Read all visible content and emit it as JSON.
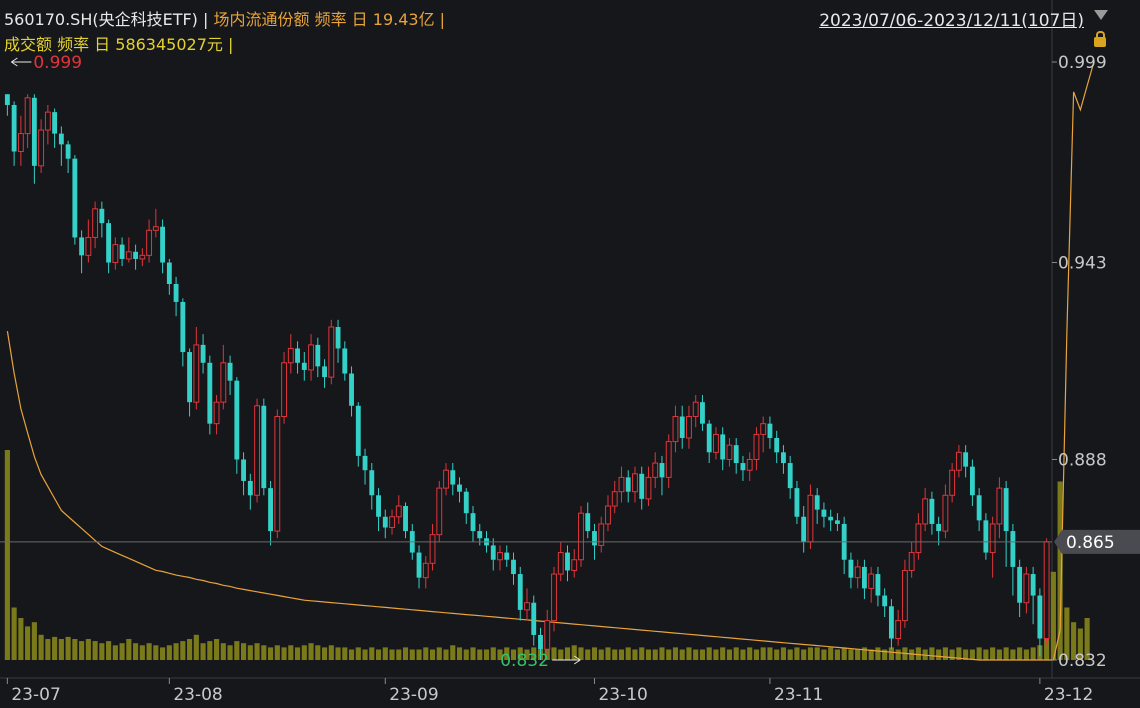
{
  "header": {
    "code": "560170.SH(央企科技ETF)",
    "sep": " | ",
    "metric": "场内流通份额 频率 日 19.43亿 |",
    "line2": "成交额 频率 日 586345027元 |",
    "date_range": "2023/07/06-2023/12/11(107日)"
  },
  "icons": {
    "dropdown": "chevron-down-icon",
    "lock": "lock-icon"
  },
  "colors": {
    "up": "#e0353a",
    "down": "#33d1c8",
    "volume": "#7a7a1a",
    "share_line": "#e8a33a",
    "crosshair": "#6a6a6a"
  },
  "chart_data": {
    "type": "candlestick",
    "price_axis": {
      "min": 0.832,
      "max": 0.999,
      "ticks": [
        "0.999",
        "0.943",
        "0.888",
        "0.832"
      ]
    },
    "x_ticks": [
      {
        "label": "23-07",
        "index": 0
      },
      {
        "label": "23-08",
        "index": 24
      },
      {
        "label": "23-09",
        "index": 56
      },
      {
        "label": "23-10",
        "index": 87
      },
      {
        "label": "23-11",
        "index": 113
      },
      {
        "label": "23-12",
        "index": 153
      }
    ],
    "high_marker": {
      "label": "0.999",
      "index": 0
    },
    "low_marker": {
      "label": "0.832",
      "index": 84
    },
    "crosshair": {
      "label": "0.865",
      "value": 0.865
    },
    "candles": [
      [
        0.99,
        0.987,
        0.99,
        0.984
      ],
      [
        0.987,
        0.974,
        0.988,
        0.97
      ],
      [
        0.974,
        0.979,
        0.984,
        0.97
      ],
      [
        0.979,
        0.989,
        0.99,
        0.975
      ],
      [
        0.989,
        0.97,
        0.99,
        0.965
      ],
      [
        0.97,
        0.98,
        0.983,
        0.968
      ],
      [
        0.98,
        0.985,
        0.987,
        0.976
      ],
      [
        0.985,
        0.979,
        0.986,
        0.975
      ],
      [
        0.979,
        0.976,
        0.981,
        0.97
      ],
      [
        0.976,
        0.972,
        0.977,
        0.968
      ],
      [
        0.972,
        0.95,
        0.973,
        0.948
      ],
      [
        0.95,
        0.945,
        0.952,
        0.94
      ],
      [
        0.945,
        0.95,
        0.955,
        0.943
      ],
      [
        0.95,
        0.958,
        0.96,
        0.947
      ],
      [
        0.958,
        0.954,
        0.96,
        0.95
      ],
      [
        0.954,
        0.943,
        0.955,
        0.94
      ],
      [
        0.943,
        0.948,
        0.95,
        0.941
      ],
      [
        0.948,
        0.944,
        0.95,
        0.942
      ],
      [
        0.944,
        0.946,
        0.95,
        0.943
      ],
      [
        0.946,
        0.944,
        0.948,
        0.941
      ],
      [
        0.944,
        0.945,
        0.947,
        0.942
      ],
      [
        0.945,
        0.952,
        0.955,
        0.943
      ],
      [
        0.952,
        0.953,
        0.958,
        0.95
      ],
      [
        0.953,
        0.943,
        0.955,
        0.94
      ],
      [
        0.943,
        0.937,
        0.944,
        0.934
      ],
      [
        0.937,
        0.932,
        0.939,
        0.928
      ],
      [
        0.932,
        0.918,
        0.933,
        0.914
      ],
      [
        0.918,
        0.904,
        0.919,
        0.9
      ],
      [
        0.904,
        0.92,
        0.925,
        0.902
      ],
      [
        0.92,
        0.915,
        0.923,
        0.912
      ],
      [
        0.915,
        0.898,
        0.917,
        0.895
      ],
      [
        0.898,
        0.904,
        0.906,
        0.895
      ],
      [
        0.904,
        0.915,
        0.92,
        0.902
      ],
      [
        0.915,
        0.91,
        0.917,
        0.906
      ],
      [
        0.91,
        0.888,
        0.911,
        0.884
      ],
      [
        0.888,
        0.882,
        0.89,
        0.878
      ],
      [
        0.882,
        0.878,
        0.884,
        0.874
      ],
      [
        0.878,
        0.903,
        0.905,
        0.876
      ],
      [
        0.903,
        0.88,
        0.905,
        0.878
      ],
      [
        0.88,
        0.868,
        0.882,
        0.864
      ],
      [
        0.868,
        0.9,
        0.902,
        0.866
      ],
      [
        0.9,
        0.915,
        0.918,
        0.898
      ],
      [
        0.915,
        0.919,
        0.923,
        0.912
      ],
      [
        0.919,
        0.915,
        0.921,
        0.912
      ],
      [
        0.915,
        0.913,
        0.918,
        0.91
      ],
      [
        0.913,
        0.92,
        0.923,
        0.91
      ],
      [
        0.92,
        0.914,
        0.922,
        0.911
      ],
      [
        0.914,
        0.911,
        0.916,
        0.908
      ],
      [
        0.911,
        0.925,
        0.927,
        0.909
      ],
      [
        0.925,
        0.919,
        0.927,
        0.915
      ],
      [
        0.919,
        0.912,
        0.921,
        0.91
      ],
      [
        0.912,
        0.903,
        0.914,
        0.9
      ],
      [
        0.903,
        0.889,
        0.904,
        0.886
      ],
      [
        0.889,
        0.885,
        0.891,
        0.881
      ],
      [
        0.885,
        0.878,
        0.887,
        0.874
      ],
      [
        0.878,
        0.872,
        0.88,
        0.868
      ],
      [
        0.872,
        0.869,
        0.874,
        0.866
      ],
      [
        0.869,
        0.872,
        0.874,
        0.867
      ],
      [
        0.872,
        0.875,
        0.878,
        0.87
      ],
      [
        0.875,
        0.868,
        0.876,
        0.866
      ],
      [
        0.868,
        0.862,
        0.87,
        0.86
      ],
      [
        0.862,
        0.855,
        0.864,
        0.852
      ],
      [
        0.855,
        0.859,
        0.861,
        0.852
      ],
      [
        0.859,
        0.867,
        0.87,
        0.857
      ],
      [
        0.867,
        0.88,
        0.882,
        0.865
      ],
      [
        0.88,
        0.885,
        0.887,
        0.878
      ],
      [
        0.885,
        0.881,
        0.887,
        0.878
      ],
      [
        0.881,
        0.879,
        0.883,
        0.876
      ],
      [
        0.879,
        0.873,
        0.88,
        0.87
      ],
      [
        0.873,
        0.868,
        0.875,
        0.865
      ],
      [
        0.868,
        0.866,
        0.87,
        0.864
      ],
      [
        0.866,
        0.864,
        0.868,
        0.862
      ],
      [
        0.864,
        0.86,
        0.866,
        0.857
      ],
      [
        0.86,
        0.862,
        0.864,
        0.857
      ],
      [
        0.862,
        0.86,
        0.864,
        0.858
      ],
      [
        0.86,
        0.856,
        0.862,
        0.853
      ],
      [
        0.856,
        0.846,
        0.858,
        0.843
      ],
      [
        0.846,
        0.848,
        0.852,
        0.843
      ],
      [
        0.848,
        0.839,
        0.85,
        0.836
      ],
      [
        0.839,
        0.835,
        0.841,
        0.832
      ],
      [
        0.835,
        0.843,
        0.846,
        0.833
      ],
      [
        0.843,
        0.856,
        0.858,
        0.84
      ],
      [
        0.856,
        0.862,
        0.865,
        0.854
      ],
      [
        0.862,
        0.857,
        0.864,
        0.854
      ],
      [
        0.857,
        0.86,
        0.863,
        0.855
      ],
      [
        0.86,
        0.873,
        0.875,
        0.858
      ],
      [
        0.873,
        0.868,
        0.876,
        0.866
      ],
      [
        0.868,
        0.864,
        0.87,
        0.86
      ],
      [
        0.864,
        0.87,
        0.872,
        0.862
      ],
      [
        0.87,
        0.875,
        0.878,
        0.868
      ],
      [
        0.875,
        0.879,
        0.882,
        0.873
      ],
      [
        0.879,
        0.883,
        0.886,
        0.876
      ],
      [
        0.883,
        0.879,
        0.885,
        0.876
      ],
      [
        0.879,
        0.884,
        0.886,
        0.876
      ],
      [
        0.884,
        0.877,
        0.886,
        0.874
      ],
      [
        0.877,
        0.883,
        0.886,
        0.875
      ],
      [
        0.883,
        0.887,
        0.89,
        0.88
      ],
      [
        0.887,
        0.883,
        0.889,
        0.878
      ],
      [
        0.883,
        0.893,
        0.895,
        0.88
      ],
      [
        0.893,
        0.9,
        0.903,
        0.89
      ],
      [
        0.9,
        0.894,
        0.903,
        0.891
      ],
      [
        0.894,
        0.9,
        0.903,
        0.891
      ],
      [
        0.9,
        0.904,
        0.906,
        0.897
      ],
      [
        0.904,
        0.898,
        0.906,
        0.896
      ],
      [
        0.898,
        0.89,
        0.899,
        0.887
      ],
      [
        0.89,
        0.895,
        0.897,
        0.888
      ],
      [
        0.895,
        0.888,
        0.897,
        0.885
      ],
      [
        0.888,
        0.892,
        0.894,
        0.886
      ],
      [
        0.892,
        0.887,
        0.894,
        0.884
      ],
      [
        0.887,
        0.885,
        0.889,
        0.882
      ],
      [
        0.885,
        0.888,
        0.89,
        0.882
      ],
      [
        0.888,
        0.895,
        0.897,
        0.885
      ],
      [
        0.895,
        0.898,
        0.9,
        0.89
      ],
      [
        0.898,
        0.894,
        0.9,
        0.891
      ],
      [
        0.894,
        0.89,
        0.896,
        0.887
      ],
      [
        0.89,
        0.887,
        0.892,
        0.884
      ],
      [
        0.887,
        0.88,
        0.889,
        0.877
      ],
      [
        0.88,
        0.872,
        0.882,
        0.87
      ],
      [
        0.872,
        0.865,
        0.875,
        0.862
      ],
      [
        0.865,
        0.878,
        0.881,
        0.863
      ],
      [
        0.878,
        0.874,
        0.88,
        0.87
      ],
      [
        0.874,
        0.872,
        0.876,
        0.869
      ],
      [
        0.872,
        0.871,
        0.874,
        0.868
      ],
      [
        0.871,
        0.87,
        0.873,
        0.868
      ],
      [
        0.87,
        0.86,
        0.872,
        0.856
      ],
      [
        0.86,
        0.855,
        0.862,
        0.852
      ],
      [
        0.855,
        0.858,
        0.86,
        0.852
      ],
      [
        0.858,
        0.852,
        0.86,
        0.849
      ],
      [
        0.852,
        0.856,
        0.858,
        0.848
      ],
      [
        0.856,
        0.85,
        0.858,
        0.847
      ],
      [
        0.85,
        0.847,
        0.852,
        0.844
      ],
      [
        0.847,
        0.838,
        0.849,
        0.835
      ],
      [
        0.838,
        0.843,
        0.846,
        0.836
      ],
      [
        0.843,
        0.857,
        0.86,
        0.841
      ],
      [
        0.857,
        0.862,
        0.865,
        0.855
      ],
      [
        0.862,
        0.87,
        0.873,
        0.86
      ],
      [
        0.87,
        0.877,
        0.88,
        0.868
      ],
      [
        0.877,
        0.87,
        0.879,
        0.867
      ],
      [
        0.87,
        0.868,
        0.872,
        0.864
      ],
      [
        0.868,
        0.878,
        0.881,
        0.866
      ],
      [
        0.878,
        0.885,
        0.887,
        0.876
      ],
      [
        0.885,
        0.89,
        0.892,
        0.883
      ],
      [
        0.89,
        0.886,
        0.892,
        0.883
      ],
      [
        0.886,
        0.878,
        0.888,
        0.875
      ],
      [
        0.878,
        0.871,
        0.88,
        0.868
      ],
      [
        0.871,
        0.862,
        0.873,
        0.86
      ],
      [
        0.862,
        0.87,
        0.872,
        0.855
      ],
      [
        0.87,
        0.88,
        0.883,
        0.866
      ],
      [
        0.88,
        0.868,
        0.882,
        0.858
      ],
      [
        0.868,
        0.858,
        0.87,
        0.85
      ],
      [
        0.858,
        0.848,
        0.86,
        0.844
      ],
      [
        0.848,
        0.856,
        0.858,
        0.845
      ],
      [
        0.856,
        0.85,
        0.858,
        0.842
      ],
      [
        0.85,
        0.838,
        0.852,
        0.833
      ],
      [
        0.838,
        0.865,
        0.866,
        0.836
      ]
    ],
    "volume": [
      1.0,
      0.25,
      0.2,
      0.16,
      0.18,
      0.12,
      0.1,
      0.11,
      0.1,
      0.11,
      0.1,
      0.09,
      0.1,
      0.09,
      0.08,
      0.09,
      0.07,
      0.08,
      0.1,
      0.08,
      0.07,
      0.08,
      0.07,
      0.06,
      0.07,
      0.08,
      0.09,
      0.1,
      0.12,
      0.08,
      0.09,
      0.1,
      0.08,
      0.07,
      0.09,
      0.08,
      0.07,
      0.08,
      0.07,
      0.06,
      0.07,
      0.06,
      0.07,
      0.06,
      0.07,
      0.08,
      0.07,
      0.06,
      0.07,
      0.06,
      0.06,
      0.05,
      0.06,
      0.05,
      0.06,
      0.05,
      0.06,
      0.05,
      0.05,
      0.06,
      0.05,
      0.05,
      0.06,
      0.05,
      0.06,
      0.05,
      0.07,
      0.06,
      0.05,
      0.06,
      0.05,
      0.05,
      0.06,
      0.05,
      0.06,
      0.05,
      0.06,
      0.05,
      0.06,
      0.05,
      0.05,
      0.06,
      0.05,
      0.06,
      0.07,
      0.06,
      0.05,
      0.06,
      0.05,
      0.06,
      0.05,
      0.05,
      0.06,
      0.05,
      0.06,
      0.05,
      0.05,
      0.06,
      0.05,
      0.06,
      0.05,
      0.06,
      0.05,
      0.05,
      0.06,
      0.05,
      0.06,
      0.05,
      0.06,
      0.05,
      0.06,
      0.05,
      0.06,
      0.06,
      0.05,
      0.06,
      0.05,
      0.06,
      0.05,
      0.06,
      0.06,
      0.05,
      0.06,
      0.05,
      0.06,
      0.05,
      0.05,
      0.06,
      0.05,
      0.06,
      0.05,
      0.06,
      0.05,
      0.06,
      0.05,
      0.06,
      0.05,
      0.06,
      0.05,
      0.06,
      0.05,
      0.06,
      0.05,
      0.05,
      0.06,
      0.05,
      0.06,
      0.05,
      0.06,
      0.05,
      0.06,
      0.05,
      0.06,
      0.07,
      0.3,
      0.42,
      0.85,
      0.25,
      0.18,
      0.15,
      0.2
    ],
    "shares": [
      0.55,
      0.48,
      0.42,
      0.38,
      0.34,
      0.31,
      0.29,
      0.27,
      0.25,
      0.24,
      0.23,
      0.22,
      0.21,
      0.2,
      0.19,
      0.185,
      0.18,
      0.175,
      0.17,
      0.165,
      0.16,
      0.155,
      0.15,
      0.148,
      0.145,
      0.142,
      0.14,
      0.138,
      0.135,
      0.133,
      0.13,
      0.128,
      0.125,
      0.123,
      0.12,
      0.118,
      0.116,
      0.114,
      0.112,
      0.11,
      0.108,
      0.106,
      0.104,
      0.102,
      0.1,
      0.099,
      0.098,
      0.097,
      0.096,
      0.095,
      0.094,
      0.093,
      0.092,
      0.091,
      0.09,
      0.089,
      0.088,
      0.087,
      0.086,
      0.085,
      0.084,
      0.083,
      0.082,
      0.081,
      0.08,
      0.079,
      0.078,
      0.077,
      0.076,
      0.075,
      0.074,
      0.073,
      0.072,
      0.071,
      0.07,
      0.069,
      0.068,
      0.067,
      0.066,
      0.065,
      0.064,
      0.063,
      0.062,
      0.061,
      0.06,
      0.059,
      0.058,
      0.057,
      0.056,
      0.055,
      0.054,
      0.053,
      0.052,
      0.051,
      0.05,
      0.049,
      0.048,
      0.047,
      0.046,
      0.045,
      0.044,
      0.043,
      0.042,
      0.041,
      0.04,
      0.039,
      0.038,
      0.037,
      0.036,
      0.035,
      0.034,
      0.033,
      0.032,
      0.031,
      0.03,
      0.029,
      0.028,
      0.027,
      0.026,
      0.025,
      0.024,
      0.023,
      0.022,
      0.021,
      0.02,
      0.019,
      0.018,
      0.017,
      0.016,
      0.015,
      0.014,
      0.013,
      0.012,
      0.011,
      0.01,
      0.009,
      0.008,
      0.007,
      0.006,
      0.005,
      0.004,
      0.003,
      0.002,
      0.001,
      0.0,
      0.0,
      0.0,
      0.0,
      0.0,
      0.0,
      0.0,
      0.0,
      0.0,
      0.0,
      0.0,
      0.0,
      0.05,
      0.55,
      0.95,
      0.92,
      0.96,
      1.0
    ]
  }
}
